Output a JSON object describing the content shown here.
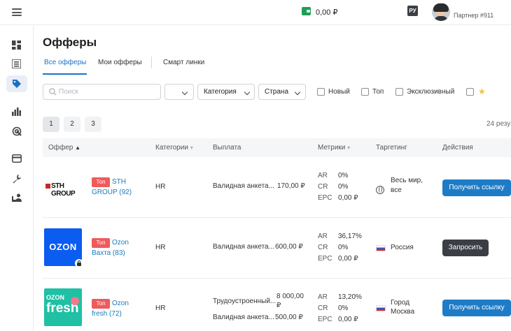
{
  "topbar": {
    "balance": "0,00 ₽",
    "lang": "РУ",
    "partner": "Партнер #911"
  },
  "page": {
    "title": "Офферы"
  },
  "tabs": [
    {
      "label": "Все офферы",
      "active": true
    },
    {
      "label": "Мои офферы",
      "active": false
    },
    {
      "label": "Смарт линки",
      "active": false
    }
  ],
  "filters": {
    "search_placeholder": "Поиск",
    "category": "Категория",
    "country": "Страна",
    "checkboxes": [
      "Новый",
      "Топ",
      "Эксклюзивный"
    ]
  },
  "pagination": {
    "pages": [
      "1",
      "2",
      "3"
    ],
    "current": "1",
    "results": "24 резу"
  },
  "table": {
    "columns": [
      "Оффер",
      "Категории",
      "Выплата",
      "Метрики",
      "Таргетинг",
      "Действия"
    ],
    "rows": [
      {
        "logo_text": "STH GROUP",
        "badge": "Топ",
        "name_line1": "STH",
        "name_line2": "GROUP (92)",
        "category": "HR",
        "payouts": [
          {
            "label": "Валидная анкета...",
            "amount": "170,00 ₽"
          }
        ],
        "metrics": {
          "AR": "0%",
          "CR": "0%",
          "EPC": "0,00 ₽"
        },
        "target_line1": "Весь мир,",
        "target_line2": "все",
        "target_line3": "",
        "action": "Получить ссылку"
      },
      {
        "logo_text": "OZON",
        "badge": "Топ",
        "name_line1": "Ozon",
        "name_line2": "Вахта (83)",
        "category": "HR",
        "payouts": [
          {
            "label": "Валидная анкета...",
            "amount": "600,00 ₽"
          }
        ],
        "metrics": {
          "AR": "36,17%",
          "CR": "0%",
          "EPC": "0,00 ₽"
        },
        "target_line1": "Россия",
        "action": "Запросить"
      },
      {
        "logo_text_top": "OZON",
        "logo_text_bottom": "fresh",
        "badge": "Топ",
        "name_line1": "Ozon",
        "name_line2": "fresh (72)",
        "category": "HR",
        "payouts": [
          {
            "label": "Трудоустроенный...",
            "amount_line1": "8 000,00",
            "amount_line2": "₽"
          },
          {
            "label": "Валидная анкета...",
            "amount": "500,00 ₽"
          }
        ],
        "metrics": {
          "AR": "13,20%",
          "CR": "0%",
          "EPC": "0,00 ₽"
        },
        "target_line1": "Город",
        "target_line2": "Москва",
        "action": "Получить ссылку"
      }
    ]
  },
  "metric_labels": {
    "ar": "AR",
    "cr": "CR",
    "epc": "EPC"
  },
  "icons": {
    "topbar": [
      "menu-icon",
      "wallet-icon",
      "avatar"
    ],
    "sidebar": [
      "dashboard-icon",
      "list-icon",
      "tag-icon",
      "stats-icon",
      "target-icon",
      "card-icon",
      "wrench-icon",
      "users-icon"
    ]
  },
  "colors": {
    "accent": "#1e7cc7",
    "badge": "#ee5b5b",
    "ozon_blue": "#0b5cf0",
    "ozon_fresh": "#1fc0a4"
  }
}
